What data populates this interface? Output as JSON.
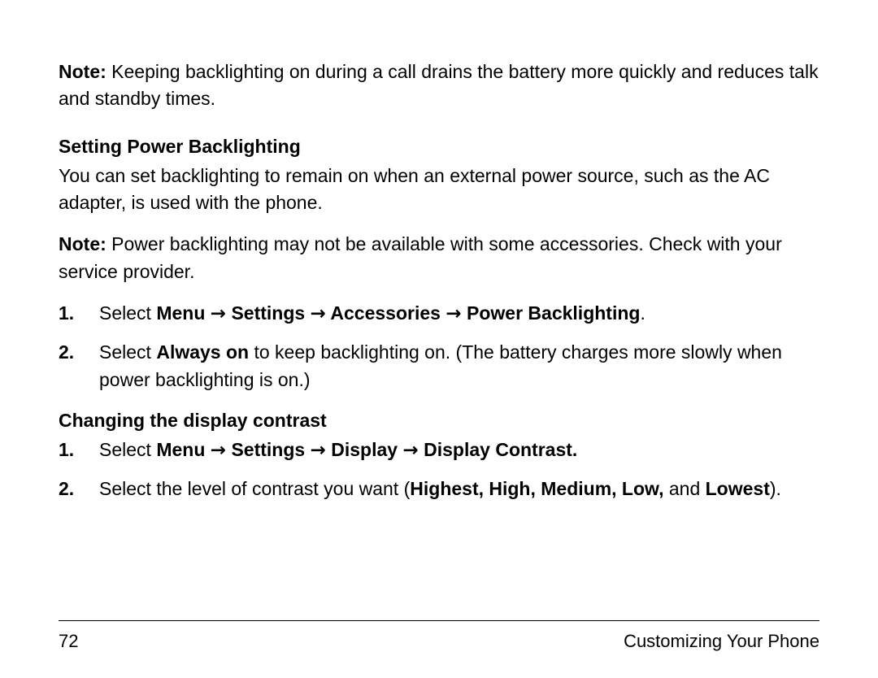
{
  "arrow": "→",
  "note1": {
    "label": "Note:",
    "text": " Keeping backlighting on during a call drains the battery more quickly and reduces talk and standby times."
  },
  "section1": {
    "heading": "Setting Power Backlighting",
    "intro": "You can set backlighting to remain on when an external power source, such as the AC adapter, is used with the phone.",
    "note": {
      "label": "Note:",
      "text": " Power backlighting may not be available with some accessories. Check with your service provider."
    },
    "steps": [
      {
        "num": "1.",
        "pre": "Select ",
        "path": [
          "Menu",
          "Settings",
          "Accessories",
          "Power Backlighting"
        ],
        "post": "."
      },
      {
        "num": "2.",
        "pre": "Select ",
        "bold1": "Always on",
        "post": " to keep backlighting on. (The battery charges more slowly when power backlighting is on.)"
      }
    ]
  },
  "section2": {
    "heading": "Changing the display contrast",
    "steps": [
      {
        "num": "1.",
        "pre": "Select ",
        "path": [
          "Menu",
          "Settings",
          "Display",
          "Display Contrast."
        ]
      },
      {
        "num": "2.",
        "pre": "Select the level of contrast you want (",
        "bold1": "Highest, High, Medium, Low,",
        "mid": " and ",
        "bold2": "Lowest",
        "post": ")."
      }
    ]
  },
  "footer": {
    "page": "72",
    "title": "Customizing Your Phone"
  }
}
